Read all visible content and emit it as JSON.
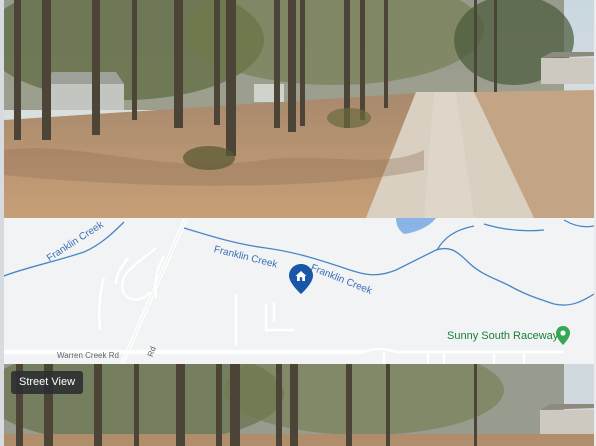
{
  "street_view_top": {
    "alt": "Street view of wooded lot with gravel driveway",
    "colors": {
      "sky": "#b9cbd6",
      "ground": "#c9a07b",
      "road": "#d6ccbb"
    }
  },
  "map": {
    "labels": {
      "creek_1": "Franklin Creek",
      "creek_2": "Franklin Creek",
      "creek_3": "Franklin Creek",
      "road_1": "Warren Creek Rd",
      "road_2": "Rd"
    },
    "poi": {
      "name": "Sunny South Raceway",
      "icon": "green-location-pin-icon",
      "color": "#34a853"
    },
    "marker": {
      "icon": "home-icon",
      "color": "#1a56a8"
    },
    "colors": {
      "land": "#f1f3f4",
      "water": "#4a86c7",
      "road": "#ffffff"
    }
  },
  "street_view_bottom": {
    "badge_label": "Street View",
    "colors": {
      "sky": "#b9cbd6",
      "ground": "#b9936f"
    }
  }
}
